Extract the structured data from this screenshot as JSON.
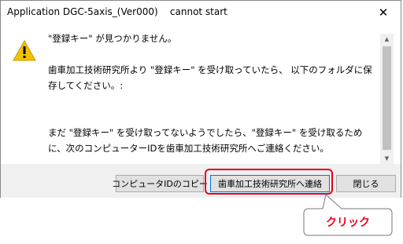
{
  "window": {
    "title": "Application DGC-5axis_(Ver000)    cannot start",
    "close_glyph": "✕"
  },
  "icon": {
    "name": "warning-icon",
    "color": "#f2c200"
  },
  "message": {
    "line1": "\"登録キー\" が見つかりません。",
    "para2": "歯車加工技術研究所より \"登録キー\" を受け取っていたら、 以下のフォルダに保存してください。:",
    "para3": "まだ \"登録キー\" を受け取ってないようでしたら、\"登録キー\" を受け取るために、次のコンピューターIDを歯車加工技術研究所へご連絡ください。"
  },
  "buttons": {
    "copy_id": "コンピュータIDのコピー",
    "contact": "歯車加工技術研究所へ連絡",
    "close": "閉じる"
  },
  "annotation": {
    "callout_text": "クリック",
    "highlight_color": "#e8001c"
  }
}
